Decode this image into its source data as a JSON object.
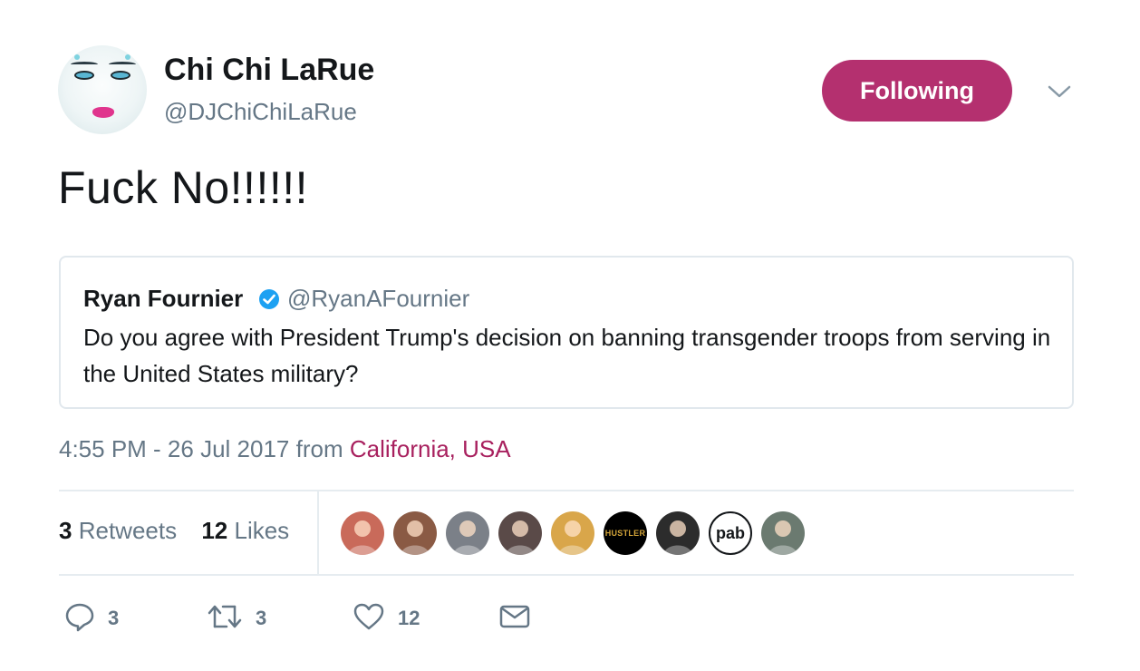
{
  "author": {
    "display_name": "Chi Chi LaRue",
    "handle": "@DJChiChiLaRue",
    "follow_label": "Following"
  },
  "tweet": {
    "text": "Fuck No!!!!!!"
  },
  "quoted": {
    "display_name": "Ryan Fournier",
    "handle": "@RyanAFournier",
    "verified": true,
    "text": "Do you agree with President Trump's decision on banning transgender troops from serving in the United States military?"
  },
  "meta": {
    "timestamp": "4:55 PM - 26 Jul 2017",
    "from_label": "from",
    "location": "California, USA"
  },
  "stats": {
    "retweets_count": "3",
    "retweets_label": "Retweets",
    "likes_count": "12",
    "likes_label": "Likes"
  },
  "likers": [
    {
      "name": "liker-avatar-1",
      "color": "#c96a5a"
    },
    {
      "name": "liker-avatar-2",
      "color": "#8a5a44"
    },
    {
      "name": "liker-avatar-3",
      "color": "#7b8088"
    },
    {
      "name": "liker-avatar-4",
      "color": "#5a4a48"
    },
    {
      "name": "liker-avatar-5",
      "color": "#d9a64a"
    },
    {
      "name": "liker-avatar-hustler",
      "color": "#000000",
      "text": "HUSTLER"
    },
    {
      "name": "liker-avatar-7",
      "color": "#2c2c2c"
    },
    {
      "name": "liker-avatar-pab",
      "color": "#ffffff",
      "text": "pab"
    },
    {
      "name": "liker-avatar-9",
      "color": "#6b7a70"
    }
  ],
  "actions": {
    "reply_count": "3",
    "retweet_count": "3",
    "like_count": "12"
  },
  "colors": {
    "accent": "#b4306f",
    "location": "#a8205e",
    "secondary_text": "#657786",
    "verified": "#1da1f2"
  }
}
